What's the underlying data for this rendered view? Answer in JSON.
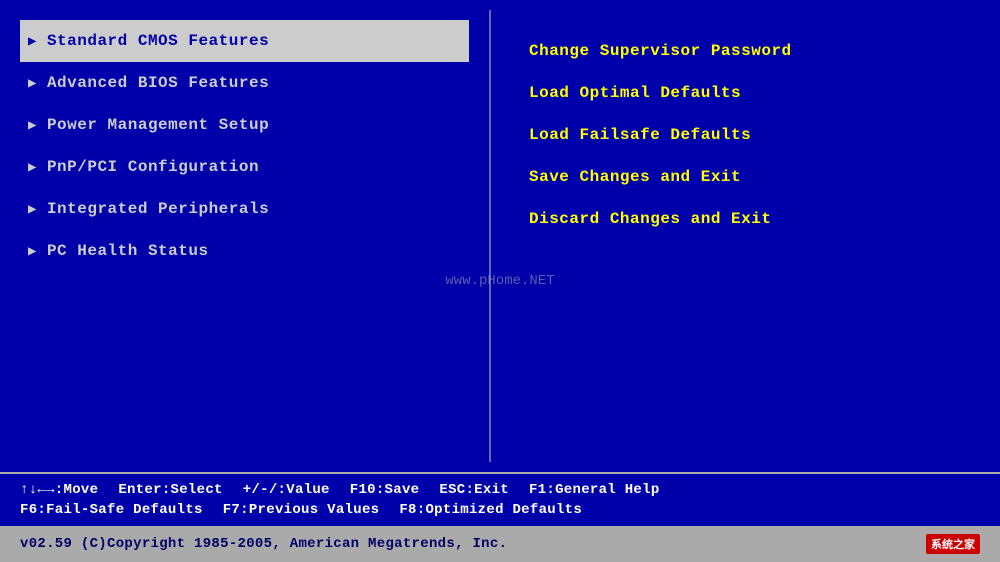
{
  "left_menu": {
    "items": [
      {
        "label": "Standard CMOS Features",
        "selected": true
      },
      {
        "label": "Advanced BIOS Features",
        "selected": false
      },
      {
        "label": "Power Management Setup",
        "selected": false
      },
      {
        "label": "PnP/PCI Configuration",
        "selected": false
      },
      {
        "label": "Integrated Peripherals",
        "selected": false
      },
      {
        "label": "PC Health Status",
        "selected": false
      }
    ]
  },
  "right_menu": {
    "items": [
      {
        "label": "Change Supervisor Password"
      },
      {
        "label": "Load Optimal Defaults"
      },
      {
        "label": "Load Failsafe Defaults"
      },
      {
        "label": "Save Changes and Exit"
      },
      {
        "label": "Discard Changes and Exit"
      }
    ]
  },
  "watermark": "www.pHome.NET",
  "bottom_bar": {
    "row1": [
      {
        "text": "↑↓←→:Move"
      },
      {
        "text": "Enter:Select"
      },
      {
        "text": "+/-/:Value"
      },
      {
        "text": "F10:Save"
      },
      {
        "text": "ESC:Exit"
      },
      {
        "text": "F1:General Help"
      }
    ],
    "row2": [
      {
        "text": "F6:Fail-Safe Defaults"
      },
      {
        "text": "F7:Previous Values"
      },
      {
        "text": "F8:Optimized Defaults"
      }
    ]
  },
  "copyright": {
    "text": "v02.59  (C)Copyright 1985-2005, American Megatrends, Inc.",
    "logo_site": "系统之家",
    "logo_badge": "家"
  },
  "colors": {
    "background": "#0000AA",
    "selected_bg": "#CCCCCC",
    "selected_fg": "#0000AA",
    "menu_fg": "#CCCCCC",
    "right_fg": "#FFFF00",
    "bottom_fg": "#FFFFFF",
    "copyright_bg": "#AAAAAA",
    "copyright_fg": "#000066"
  }
}
